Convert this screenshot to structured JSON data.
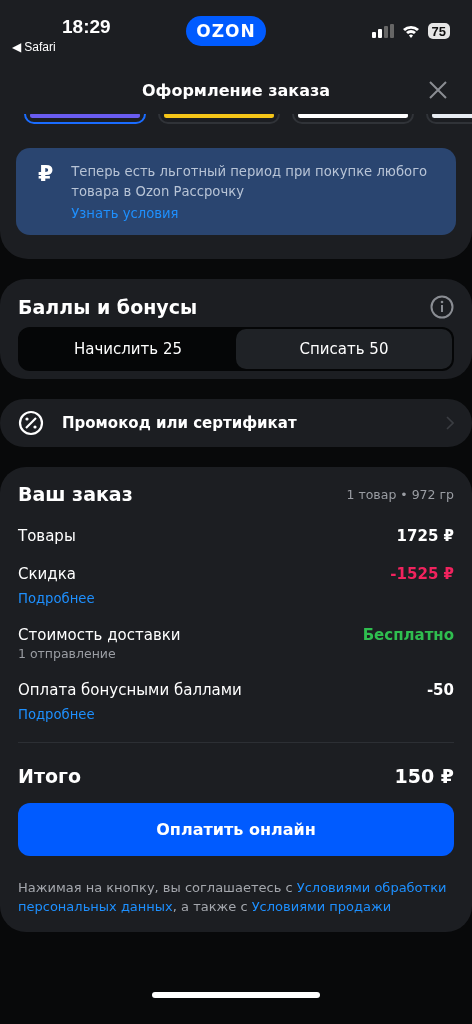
{
  "status_bar": {
    "time": "18:29",
    "back": "◀ Safari",
    "logo": "OZON",
    "battery": "75"
  },
  "header": {
    "title": "Оформление заказа"
  },
  "payment_cards": [
    {
      "color": "#6a5cf0",
      "selected": true
    },
    {
      "color": "#f5c518",
      "selected": false
    },
    {
      "color": "#ffffff",
      "selected": false
    },
    {
      "color": "#e8ecf2",
      "selected": false
    }
  ],
  "banner": {
    "icon": "₽",
    "text": "Теперь есть льготный период при покупке любого товара в Ozon Рассрочку",
    "link": "Узнать условия"
  },
  "bonuses": {
    "title": "Баллы и бонусы",
    "options": [
      {
        "label": "Начислить 25",
        "selected": false
      },
      {
        "label": "Списать 50",
        "selected": true
      }
    ]
  },
  "promo": {
    "label": "Промокод или сертификат"
  },
  "order": {
    "title": "Ваш заказ",
    "summary": "1 товар • 972 гр",
    "rows": [
      {
        "label": "Товары",
        "value": "1725 ₽",
        "kind": "normal"
      },
      {
        "label": "Скидка",
        "value": "-1525 ₽",
        "kind": "discount",
        "link": "Подробнее"
      },
      {
        "label": "Стоимость доставки",
        "value": "Бесплатно",
        "kind": "free",
        "note": "1 отправление"
      },
      {
        "label": "Оплата бонусными баллами",
        "value": "-50",
        "kind": "normal",
        "link": "Подробнее"
      }
    ],
    "total_label": "Итого",
    "total": "150 ₽",
    "pay_button": "Оплатить онлайн",
    "legal": [
      {
        "kind": "text",
        "text": "Нажимая на кнопку, вы соглашаетесь с "
      },
      {
        "kind": "link",
        "text": "Условиями обработки"
      },
      {
        "kind": "link",
        "text": "персональных данных"
      },
      {
        "kind": "text",
        "text": ", а также с "
      },
      {
        "kind": "link",
        "text": "Условиями продажи"
      }
    ]
  }
}
